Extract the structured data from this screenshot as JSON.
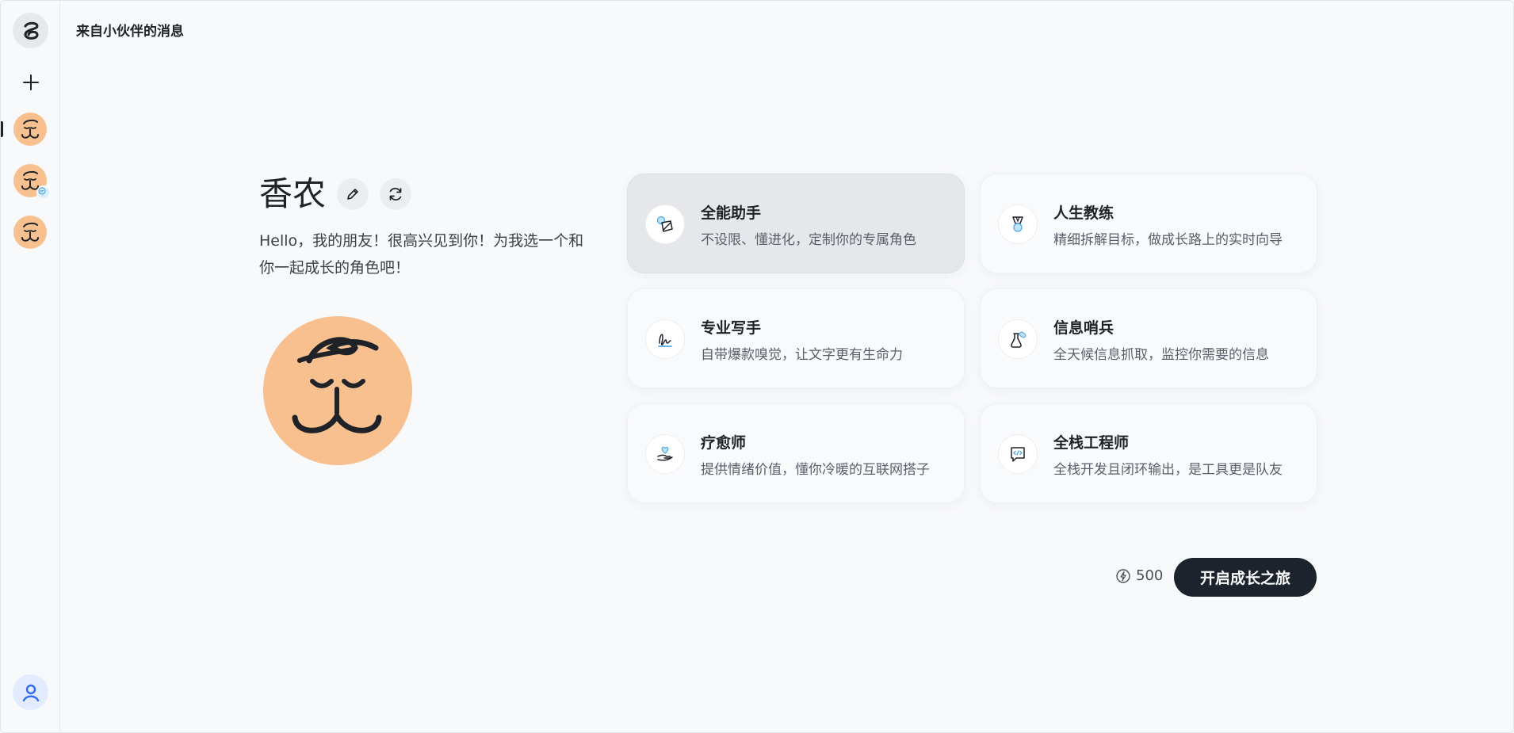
{
  "header": {
    "title": "来自小伙伴的消息"
  },
  "sidebar": {
    "logo_icon": "logo-icon",
    "new_icon": "plus-icon",
    "avatars": [
      {
        "name": "avatar-1",
        "active": true
      },
      {
        "name": "avatar-2",
        "badge": "chat-bubble-icon"
      },
      {
        "name": "avatar-3"
      }
    ],
    "user_icon": "user-icon"
  },
  "character": {
    "name": "香农",
    "greeting": "Hello，我的朋友！很高兴见到你！为我选一个和你一起成长的角色吧！"
  },
  "roles": [
    {
      "title": "全能助手",
      "desc": "不设限、懂进化，定制你的专属角色",
      "icon": "magic-icon",
      "selected": true
    },
    {
      "title": "人生教练",
      "desc": "精细拆解目标，做成长路上的实时向导",
      "icon": "medal-icon"
    },
    {
      "title": "专业写手",
      "desc": "自带爆款嗅觉，让文字更有生命力",
      "icon": "signature-icon"
    },
    {
      "title": "信息哨兵",
      "desc": "全天候信息抓取，监控你需要的信息",
      "icon": "flask-icon"
    },
    {
      "title": "疗愈师",
      "desc": "提供情绪价值，懂你冷暖的互联网搭子",
      "icon": "heart-hand-icon"
    },
    {
      "title": "全栈工程师",
      "desc": "全栈开发且闭环输出，是工具更是队友",
      "icon": "code-icon"
    }
  ],
  "footer": {
    "credits": "500",
    "start_label": "开启成长之旅"
  },
  "colors": {
    "avatar_bg": "#f8c08f",
    "button_dark": "#1c232c",
    "accent_blue": "#4fa9e6"
  }
}
